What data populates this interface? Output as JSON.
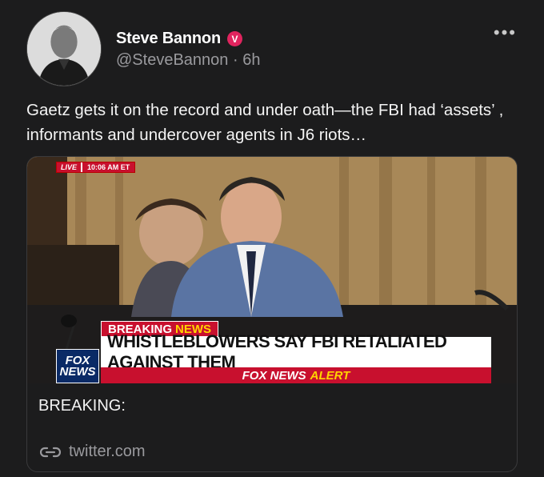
{
  "author": {
    "name": "Steve Bannon",
    "verified_badge": "V",
    "handle": "@SteveBannon",
    "separator": "·",
    "time": "6h"
  },
  "menu": {
    "more_label": "•••"
  },
  "tweet": {
    "text": "Gaetz gets it on the record and under oath—the FBI had ‘assets’ , informants and undercover agents in J6 riots…"
  },
  "card": {
    "media": {
      "live_label": "LIVE",
      "live_time": "10:06 AM ET",
      "breaking_label": "BREAKING",
      "breaking_news": "NEWS",
      "headline": "WHISTLEBLOWERS SAY FBI RETALIATED AGAINST THEM",
      "alert_label": "FOX NEWS",
      "alert_word": "ALERT",
      "logo_line1": "FOX",
      "logo_line2": "NEWS"
    },
    "title": "BREAKING:",
    "domain": "twitter.com"
  },
  "colors": {
    "background": "#1c1c1d",
    "verified": "#e0245e",
    "secondary_text": "#9a9a9e",
    "fox_red": "#c8102e",
    "fox_yellow": "#ffd400"
  }
}
